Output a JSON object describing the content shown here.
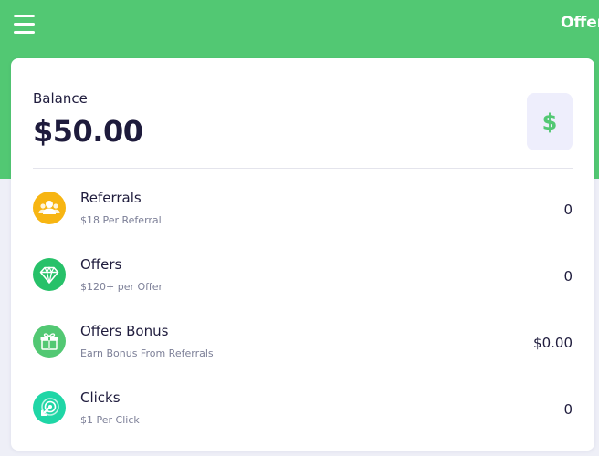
{
  "header": {
    "title": "Offers",
    "menu_icon": "hamburger-menu-icon"
  },
  "balance": {
    "label": "Balance",
    "amount": "$50.00",
    "icon_glyph": "$",
    "icon": "dollar-sign-icon"
  },
  "rows": [
    {
      "title": "Referrals",
      "subtitle": "$18 Per Referral",
      "value": "0",
      "icon": "users-icon",
      "icon_color": "#f7b512"
    },
    {
      "title": "Offers",
      "subtitle": "$120+ per Offer",
      "value": "0",
      "icon": "diamond-icon",
      "icon_color": "#27c169"
    },
    {
      "title": "Offers Bonus",
      "subtitle": "Earn Bonus From Referrals",
      "value": "$0.00",
      "icon": "gift-icon",
      "icon_color": "#52c873"
    },
    {
      "title": "Clicks",
      "subtitle": "$1 Per Click",
      "value": "0",
      "icon": "target-click-icon",
      "icon_color": "#1fd6a6"
    }
  ],
  "colors": {
    "header_green": "#52c873",
    "page_background": "#eeeff7",
    "text_dark": "#1f1c3d",
    "text_muted": "#7c7f97"
  }
}
